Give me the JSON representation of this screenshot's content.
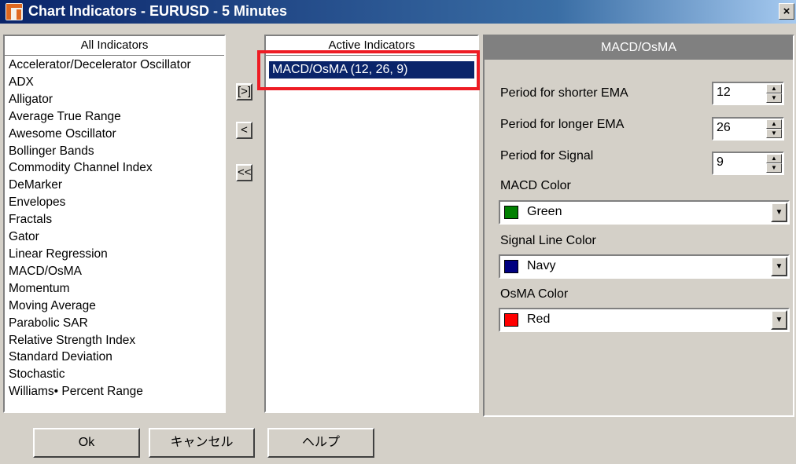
{
  "window": {
    "title": "Chart Indicators - EURUSD - 5 Minutes",
    "close_label": "×"
  },
  "all_indicators": {
    "header": "All Indicators",
    "items": [
      "Accelerator/Decelerator Oscillator",
      "ADX",
      "Alligator",
      "Average True Range",
      "Awesome Oscillator",
      "Bollinger Bands",
      "Commodity Channel Index",
      "DeMarker",
      "Envelopes",
      "Fractals",
      "Gator",
      "Linear Regression",
      "MACD/OsMA",
      "Momentum",
      "Moving Average",
      "Parabolic SAR",
      "Relative Strength Index",
      "Standard Deviation",
      "Stochastic",
      "Williams• Percent Range"
    ]
  },
  "transfer_buttons": {
    "add": "[>]",
    "remove": "<",
    "remove_all": "<<"
  },
  "active_indicators": {
    "header": "Active Indicators",
    "items": [
      "MACD/OsMA (12, 26, 9)"
    ]
  },
  "properties": {
    "header": "MACD/OsMA",
    "short_ema_label": "Period for shorter EMA",
    "short_ema_value": "12",
    "long_ema_label": "Period for longer EMA",
    "long_ema_value": "26",
    "signal_label": "Period for Signal",
    "signal_value": "9",
    "macd_color_label": "MACD Color",
    "macd_color_value": "Green",
    "macd_color_hex": "#008000",
    "signal_color_label": "Signal Line Color",
    "signal_color_value": "Navy",
    "signal_color_hex": "#000080",
    "osma_color_label": "OsMA Color",
    "osma_color_value": "Red",
    "osma_color_hex": "#ff0000"
  },
  "footer": {
    "ok": "Ok",
    "cancel": "キャンセル",
    "help": "ヘルプ"
  },
  "colors": {
    "selection": "#0a246a",
    "highlight_box": "#ee1c24"
  }
}
